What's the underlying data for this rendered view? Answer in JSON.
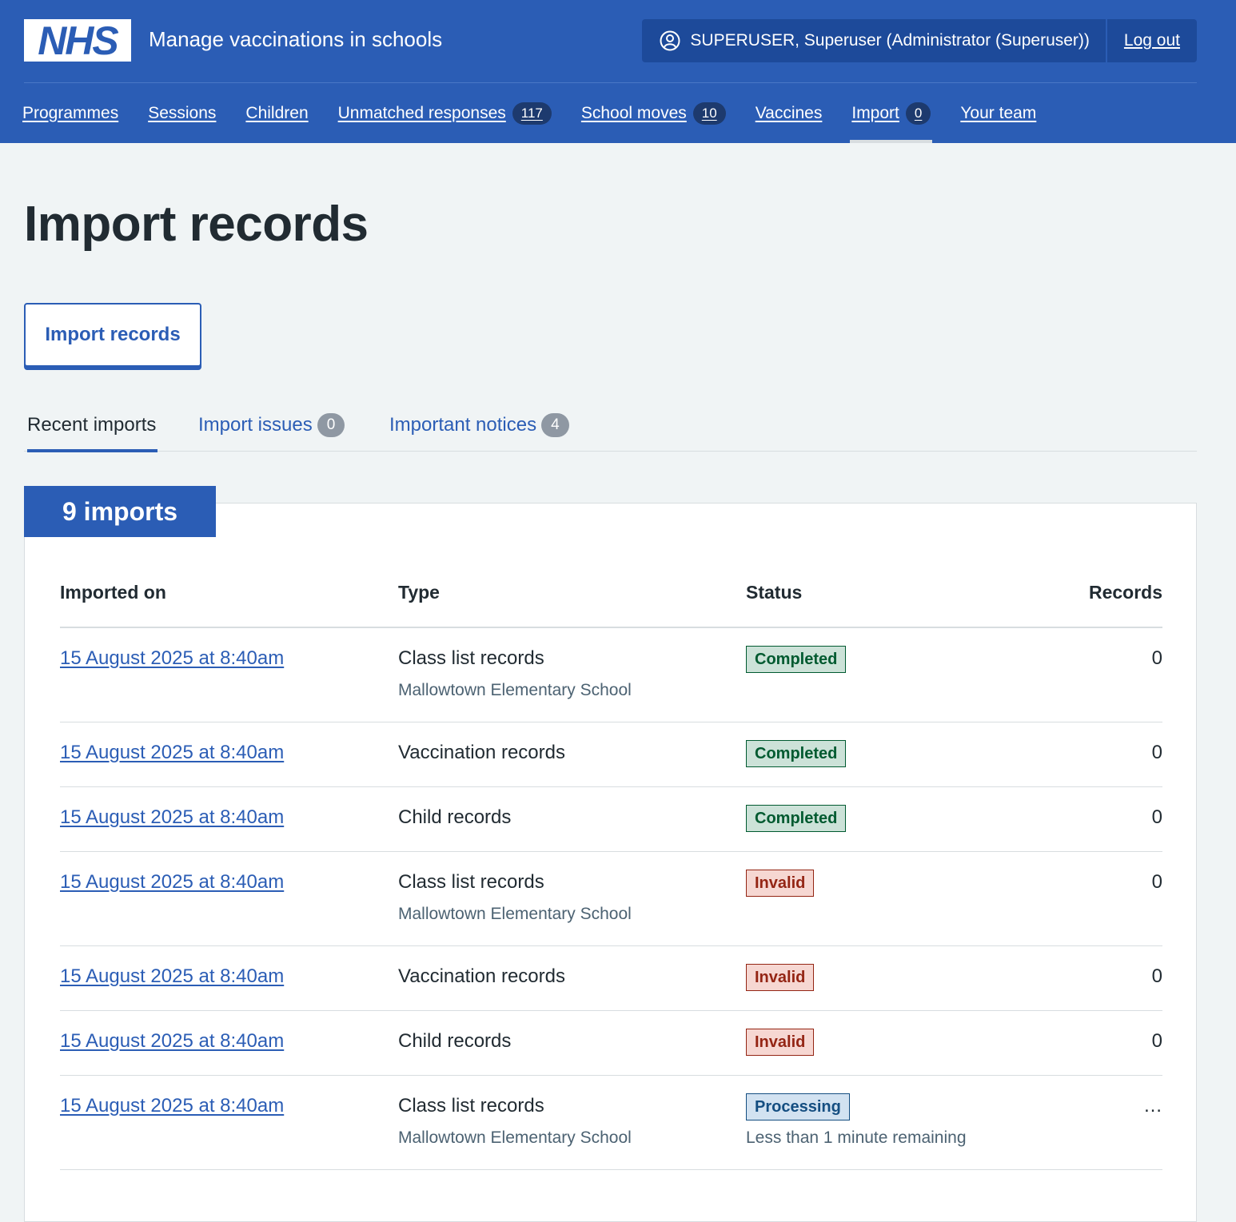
{
  "header": {
    "logo_text": "NHS",
    "service_name": "Manage vaccinations in schools",
    "user_label": "SUPERUSER, Superuser (Administrator (Superuser))",
    "logout_label": "Log out"
  },
  "nav": {
    "items": [
      {
        "label": "Programmes"
      },
      {
        "label": "Sessions"
      },
      {
        "label": "Children"
      },
      {
        "label": "Unmatched responses",
        "badge": "117"
      },
      {
        "label": "School moves",
        "badge": "10"
      },
      {
        "label": "Vaccines"
      },
      {
        "label": "Import",
        "badge": "0"
      },
      {
        "label": "Your team"
      }
    ]
  },
  "page": {
    "title": "Import records",
    "import_button": "Import records"
  },
  "tabs": [
    {
      "label": "Recent imports"
    },
    {
      "label": "Import issues",
      "badge": "0"
    },
    {
      "label": "Important notices",
      "badge": "4"
    }
  ],
  "imports": {
    "heading": "9 imports",
    "columns": {
      "imported_on": "Imported on",
      "type": "Type",
      "status": "Status",
      "records": "Records"
    },
    "rows": [
      {
        "date": "15 August 2025 at 8:40am",
        "type": "Class list records",
        "school": "Mallowtown Elementary School",
        "status": "Completed",
        "records": "0"
      },
      {
        "date": "15 August 2025 at 8:40am",
        "type": "Vaccination records",
        "status": "Completed",
        "records": "0"
      },
      {
        "date": "15 August 2025 at 8:40am",
        "type": "Child records",
        "status": "Completed",
        "records": "0"
      },
      {
        "date": "15 August 2025 at 8:40am",
        "type": "Class list records",
        "school": "Mallowtown Elementary School",
        "status": "Invalid",
        "records": "0"
      },
      {
        "date": "15 August 2025 at 8:40am",
        "type": "Vaccination records",
        "status": "Invalid",
        "records": "0"
      },
      {
        "date": "15 August 2025 at 8:40am",
        "type": "Child records",
        "status": "Invalid",
        "records": "0"
      },
      {
        "date": "15 August 2025 at 8:40am",
        "type": "Class list records",
        "school": "Mallowtown Elementary School",
        "status": "Processing",
        "status_note": "Less than 1 minute remaining",
        "records": "…"
      }
    ]
  },
  "colors": {
    "brand_blue": "#2b5db5",
    "completed": "#005a30",
    "invalid": "#942514",
    "processing": "#144e81"
  }
}
